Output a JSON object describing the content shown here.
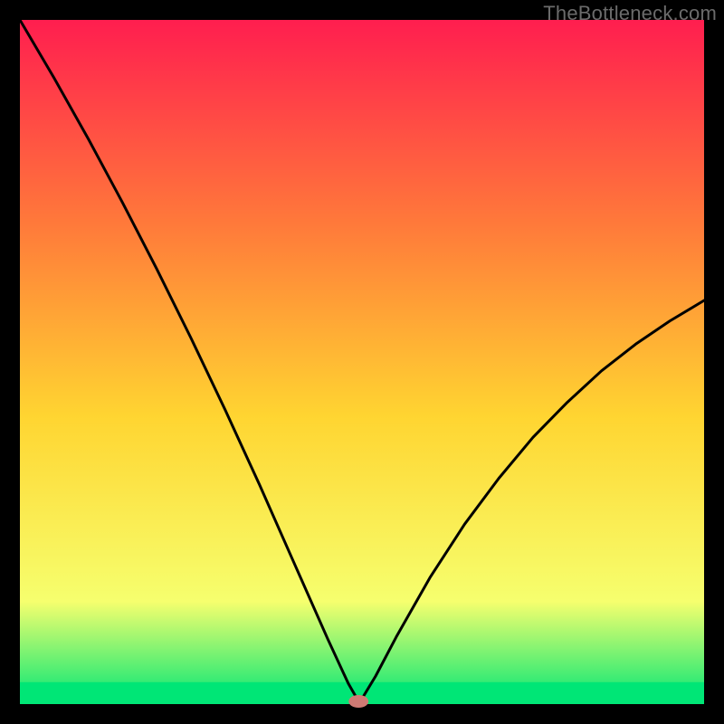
{
  "watermark": "TheBottleneck.com",
  "chart_data": {
    "type": "line",
    "title": "",
    "xlabel": "",
    "ylabel": "",
    "xlim": [
      0,
      100
    ],
    "ylim": [
      0,
      100
    ],
    "grid": false,
    "legend": false,
    "series": [
      {
        "name": "bottleneck-curve",
        "x": [
          0,
          5,
          10,
          15,
          20,
          25,
          30,
          35,
          40,
          45,
          48,
          49.5,
          50,
          52,
          55,
          60,
          65,
          70,
          75,
          80,
          85,
          90,
          95,
          100
        ],
        "values": [
          100,
          91.5,
          82.6,
          73.3,
          63.6,
          53.5,
          43.0,
          32.1,
          20.8,
          9.5,
          3.0,
          0.4,
          0.8,
          4.1,
          9.8,
          18.6,
          26.3,
          33.0,
          39.0,
          44.1,
          48.7,
          52.6,
          56.0,
          59.0
        ]
      }
    ],
    "marker": {
      "x": 49.5,
      "y": 0.4
    },
    "green_band_top": 3.2,
    "colors": {
      "gradient_top": "#ff1e4f",
      "gradient_upper_mid": "#ff7a3a",
      "gradient_mid": "#ffd531",
      "gradient_lower_mid": "#f6ff6e",
      "gradient_bottom": "#00e676",
      "frame": "#000000",
      "line": "#000000",
      "marker_fill": "#cf7a74"
    },
    "frame_thickness_px": 22
  }
}
